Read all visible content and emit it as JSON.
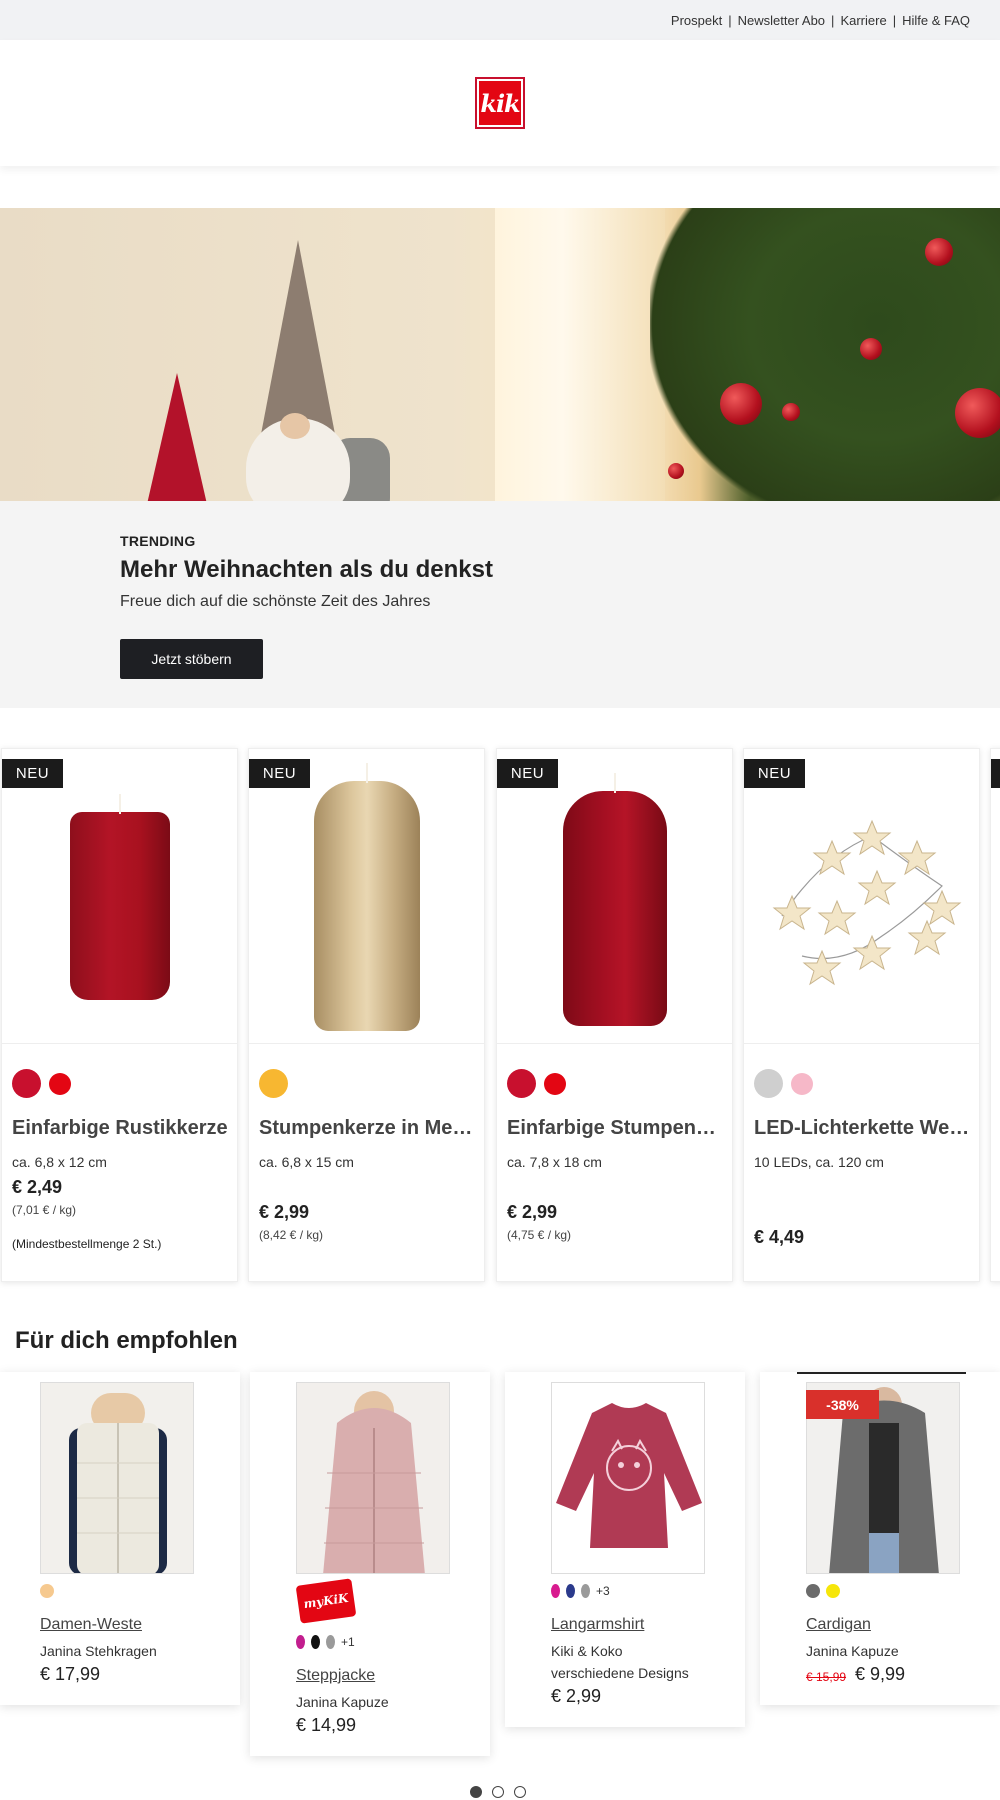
{
  "topbar": {
    "links": [
      "Prospekt",
      "Newsletter Abo",
      "Karriere",
      "Hilfe & FAQ"
    ]
  },
  "logo": {
    "text": "kik"
  },
  "promo": {
    "eyebrow": "TRENDING",
    "title": "Mehr Weihnachten als du denkst",
    "subtitle": "Freue dich auf die schönste Zeit des Jahres",
    "cta": "Jetzt stöbern"
  },
  "products": [
    {
      "badge": "NEU",
      "name": "Einfarbige Rustikkerze",
      "dims": "ca. 6,8 x 12 cm",
      "price": "€ 2,49",
      "unit": "(7,01 € / kg)",
      "note": "(Mindestbestellmenge 2 St.)",
      "swatches": [
        "#c8102e",
        "#e30613"
      ]
    },
    {
      "badge": "NEU",
      "name": "Stumpenkerze in Metallic-Optik",
      "dims": "ca. 6,8 x 15 cm",
      "price": "€ 2,99",
      "unit": "(8,42 € / kg)",
      "swatches": [
        "#f7b731"
      ]
    },
    {
      "badge": "NEU",
      "name": "Einfarbige Stumpenkerze",
      "dims": "ca. 7,8 x 18 cm",
      "price": "€ 2,99",
      "unit": "(4,75 € / kg)",
      "swatches": [
        "#c8102e",
        "#e30613"
      ]
    },
    {
      "badge": "NEU",
      "name": "LED-Lichterkette Weihnachten",
      "dims": "10 LEDs, ca. 120 cm",
      "price": "€ 4,49",
      "swatches": [
        "#cfcfcf",
        "#f6b8c8"
      ]
    }
  ],
  "recommended": {
    "title": "Für dich empfohlen",
    "items": [
      {
        "name": "Damen-Weste",
        "line1": "Janina Stehkragen",
        "price": "€ 17,99",
        "swatches": [
          "#f6c98f"
        ]
      },
      {
        "badge": "myKiK",
        "name": "Steppjacke",
        "line1": "Janina Kapuze",
        "price": "€ 14,99",
        "swatches": [
          "#c21e8e",
          "#111111",
          "#9a9a9a"
        ],
        "more": "+1"
      },
      {
        "name": "Langarmshirt",
        "line1": "Kiki & Koko",
        "line2": "verschiedene Designs",
        "price": "€ 2,99",
        "swatches": [
          "#d81b8f",
          "#2b3a8c",
          "#9a9a9a"
        ],
        "more": "+3"
      },
      {
        "discount": "-38%",
        "name": "Cardigan",
        "line1": "Janina Kapuze",
        "old_price": "€ 15,99",
        "price": "€ 9,99",
        "swatches": [
          "#6b6b6b",
          "#f6e60a"
        ]
      }
    ]
  },
  "pagination": {
    "count": 3,
    "active": 0
  }
}
